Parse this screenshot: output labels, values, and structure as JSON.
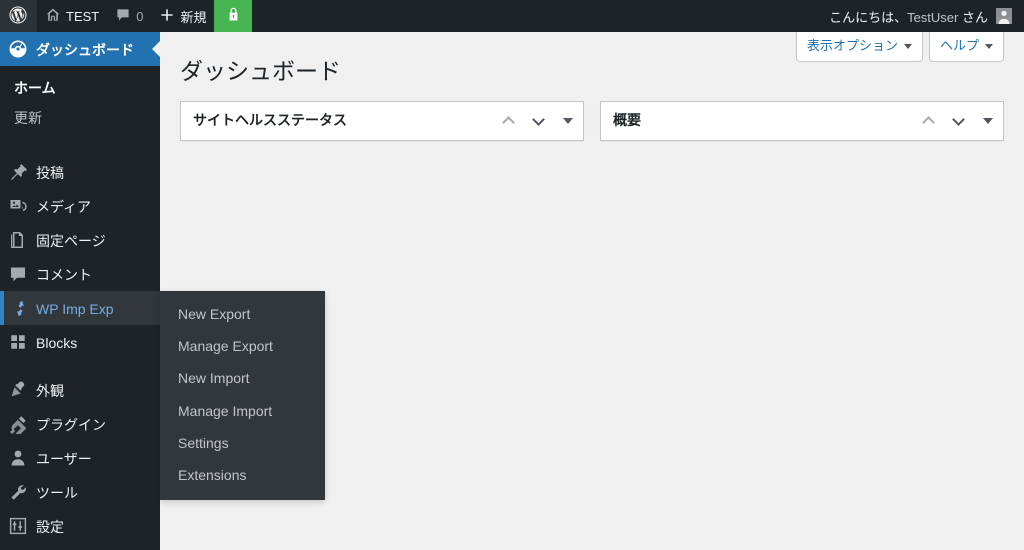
{
  "adminbar": {
    "logo_icon": "wordpress-logo-icon",
    "site_name": "TEST",
    "site_icon": "home-icon",
    "comments": {
      "icon": "comment-bubble-icon",
      "count": "0"
    },
    "new_label": "新規",
    "new_icon": "plus-icon",
    "ssl_icon": "lock-icon",
    "ssl_color": "#46b450",
    "greeting_prefix": "こんにちは、",
    "user_name": "TestUser",
    "greeting_suffix": " さん",
    "avatar_icon": "user-avatar-icon"
  },
  "sidebar": {
    "items": [
      {
        "label": "ダッシュボード",
        "icon": "dashboard-gauge-icon",
        "state": "current",
        "name": "dashboard"
      },
      {
        "label": "投稿",
        "icon": "pin-icon",
        "state": "normal",
        "name": "posts"
      },
      {
        "label": "メディア",
        "icon": "media-icon",
        "state": "normal",
        "name": "media"
      },
      {
        "label": "固定ページ",
        "icon": "page-icon",
        "state": "normal",
        "name": "pages"
      },
      {
        "label": "コメント",
        "icon": "comment-bubble-icon",
        "state": "normal",
        "name": "comments"
      },
      {
        "label": "WP Imp Exp",
        "icon": "import-export-arrows-icon",
        "state": "open",
        "name": "wp-imp-exp"
      },
      {
        "label": "Blocks",
        "icon": "blocks-grid-icon",
        "state": "normal",
        "name": "blocks"
      },
      {
        "label": "外観",
        "icon": "appearance-brush-icon",
        "state": "normal",
        "name": "appearance"
      },
      {
        "label": "プラグイン",
        "icon": "plugin-plug-icon",
        "state": "normal",
        "name": "plugins"
      },
      {
        "label": "ユーザー",
        "icon": "user-icon",
        "state": "normal",
        "name": "users"
      },
      {
        "label": "ツール",
        "icon": "tools-wrench-icon",
        "state": "normal",
        "name": "tools"
      },
      {
        "label": "設定",
        "icon": "settings-sliders-icon",
        "state": "normal",
        "name": "settings"
      }
    ],
    "dashboard_submenu": [
      {
        "label": "ホーム",
        "current": true
      },
      {
        "label": "更新",
        "current": false
      }
    ],
    "flyout": {
      "owner": "WP Imp Exp",
      "items": [
        {
          "label": "New Export"
        },
        {
          "label": "Manage Export"
        },
        {
          "label": "New Import"
        },
        {
          "label": "Manage Import"
        },
        {
          "label": "Settings"
        },
        {
          "label": "Extensions"
        }
      ]
    },
    "colors": {
      "background": "#1d2327",
      "current_background": "#2271b1",
      "hover_background": "#32373c",
      "accent_text": "#72aee6",
      "accent_border": "#3582c4"
    }
  },
  "screen_meta": {
    "screen_options_label": "表示オプション",
    "help_label": "ヘルプ",
    "caret_icon": "caret-down-icon"
  },
  "main": {
    "page_title": "ダッシュボード",
    "widgets": [
      {
        "title": "サイトヘルスステータス",
        "name": "site-health-status",
        "order_up_icon": "chevron-up-icon",
        "order_down_icon": "chevron-down-icon",
        "toggle_icon": "triangle-down-icon"
      },
      {
        "title": "概要",
        "name": "at-a-glance",
        "order_up_icon": "chevron-up-icon",
        "order_down_icon": "chevron-down-icon",
        "toggle_icon": "triangle-down-icon"
      }
    ]
  },
  "theme": {
    "content_background": "#f0f0f1",
    "widget_border": "#c3c4c7",
    "link_color": "#2271b1"
  }
}
